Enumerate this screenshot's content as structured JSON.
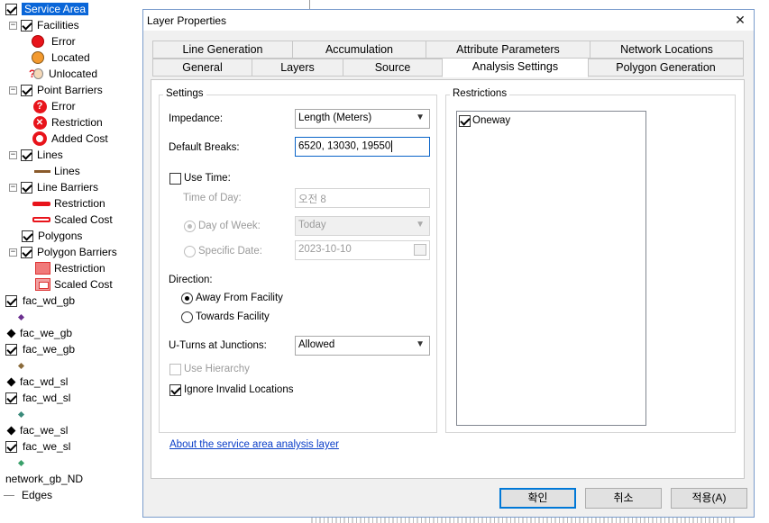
{
  "toc": {
    "service_area": "Service Area",
    "facilities": "Facilities",
    "error": "Error",
    "located": "Located",
    "unlocated": "Unlocated",
    "point_barriers": "Point Barriers",
    "pb_error": "Error",
    "pb_restriction": "Restriction",
    "pb_added_cost": "Added Cost",
    "lines": "Lines",
    "lines_sym": "Lines",
    "line_barriers": "Line Barriers",
    "lb_restriction": "Restriction",
    "lb_scaled_cost": "Scaled Cost",
    "polygons": "Polygons",
    "polygon_barriers": "Polygon Barriers",
    "pgb_restriction": "Restriction",
    "pgb_scaled_cost": "Scaled Cost",
    "layers": [
      "fac_wd_gb",
      "fac_we_gb",
      "fac_we_gb",
      "fac_wd_sl",
      "fac_wd_sl",
      "fac_we_sl",
      "fac_we_sl"
    ],
    "network": "network_gb_ND",
    "edges": "Edges"
  },
  "dialog": {
    "title": "Layer Properties",
    "close": "✕",
    "tabs_top": [
      "Line Generation",
      "Accumulation",
      "Attribute Parameters",
      "Network Locations"
    ],
    "tabs_bottom": [
      "General",
      "Layers",
      "Source",
      "Analysis Settings",
      "Polygon Generation"
    ],
    "settings": {
      "group": "Settings",
      "impedance_label": "Impedance:",
      "impedance_value": "Length (Meters)",
      "breaks_label": "Default Breaks:",
      "breaks_value": "6520, 13030, 19550",
      "use_time": "Use Time:",
      "time_of_day_label": "Time of Day:",
      "time_of_day_value": "오전 8",
      "day_of_week_label": "Day of Week:",
      "day_of_week_value": "Today",
      "specific_date_label": "Specific Date:",
      "specific_date_value": "2023-10-10",
      "direction_label": "Direction:",
      "away": "Away From Facility",
      "towards": "Towards Facility",
      "uturns_label": "U-Turns at Junctions:",
      "uturns_value": "Allowed",
      "use_hierarchy": "Use Hierarchy",
      "ignore_invalid": "Ignore Invalid Locations"
    },
    "restrictions": {
      "group": "Restrictions",
      "items": [
        "Oneway"
      ]
    },
    "about_link": "About the service area analysis layer",
    "buttons": {
      "ok": "확인",
      "cancel": "취소",
      "apply": "적용(A)"
    }
  }
}
